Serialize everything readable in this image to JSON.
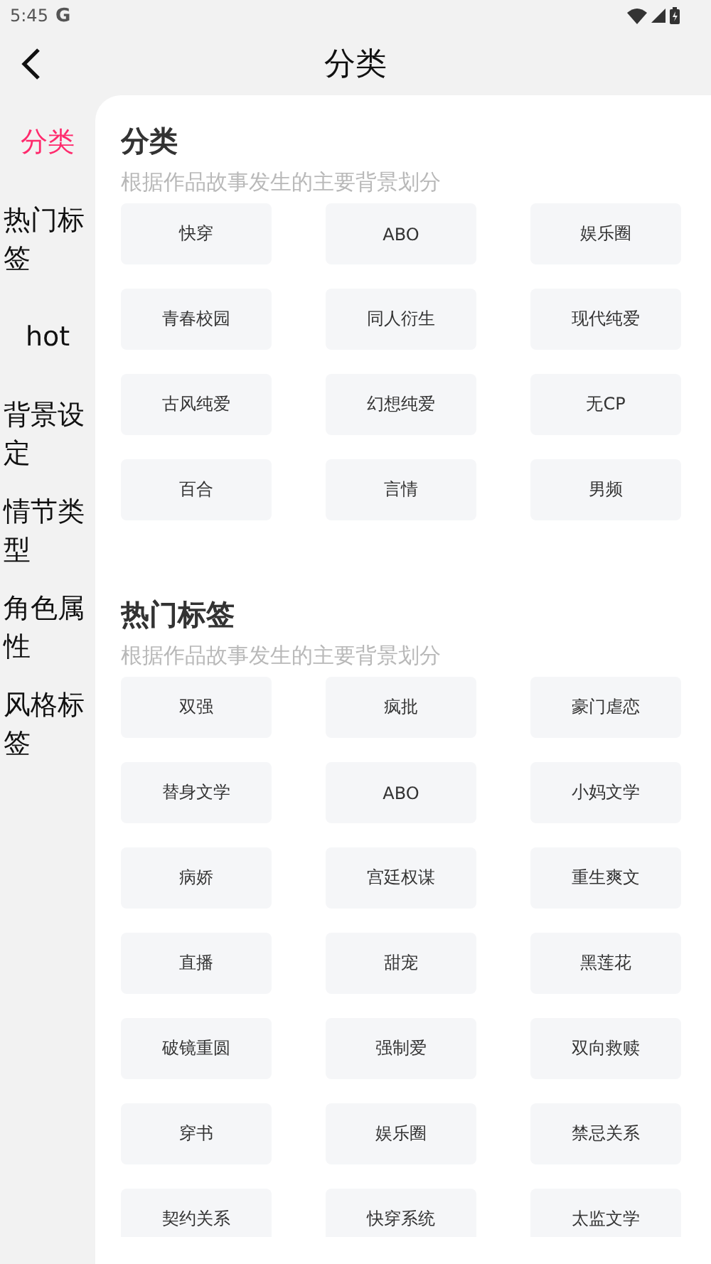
{
  "status_bar": {
    "time": "5:45",
    "g_label": "G"
  },
  "header": {
    "title": "分类"
  },
  "sidebar": {
    "items": [
      {
        "label": "分类",
        "selected": true
      },
      {
        "label": "热门标签",
        "selected": false
      },
      {
        "label": "hot",
        "selected": false
      },
      {
        "label": "背景设定",
        "selected": false
      },
      {
        "label": "情节类型",
        "selected": false
      },
      {
        "label": "角色属性",
        "selected": false
      },
      {
        "label": "风格标签",
        "selected": false
      }
    ]
  },
  "sections": [
    {
      "title": "分类",
      "subtitle": "根据作品故事发生的主要背景划分",
      "tags": [
        "快穿",
        "ABO",
        "娱乐圈",
        "青春校园",
        "同人衍生",
        "现代纯爱",
        "古风纯爱",
        "幻想纯爱",
        "无CP",
        "百合",
        "言情",
        "男频"
      ]
    },
    {
      "title": "热门标签",
      "subtitle": "根据作品故事发生的主要背景划分",
      "tags": [
        "双强",
        "疯批",
        "豪门虐恋",
        "替身文学",
        "ABO",
        "小妈文学",
        "病娇",
        "宫廷权谋",
        "重生爽文",
        "直播",
        "甜宠",
        "黑莲花",
        "破镜重圆",
        "强制爱",
        "双向救赎",
        "穿书",
        "娱乐圈",
        "禁忌关系",
        "契约关系",
        "快穿系统",
        "太监文学"
      ]
    }
  ]
}
